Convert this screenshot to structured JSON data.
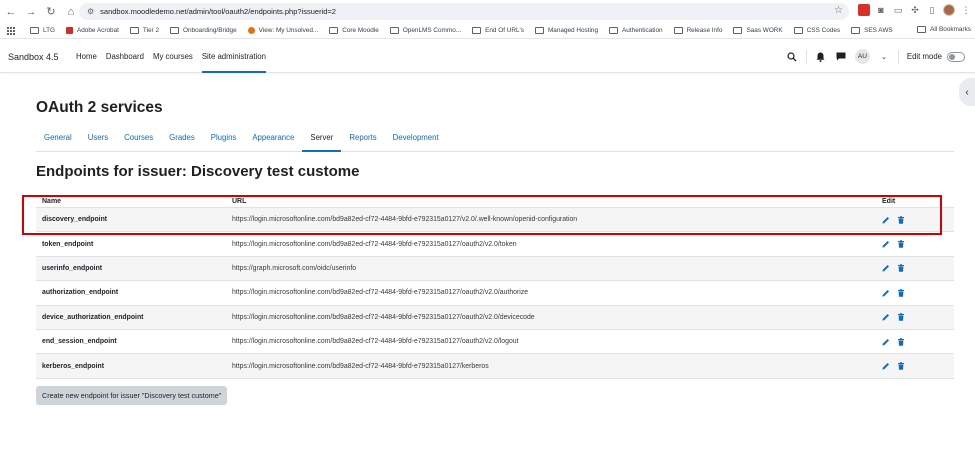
{
  "browser": {
    "url": "sandbox.moodledemo.net/admin/tool/oauth2/endpoints.php?issuerid=2",
    "bookmarks": [
      {
        "label": "LTG",
        "icon": "folder-icon"
      },
      {
        "label": "Adobe Acrobat",
        "icon": "adobe-icon"
      },
      {
        "label": "Tier 2",
        "icon": "folder-icon"
      },
      {
        "label": "Onboarding/Bridge",
        "icon": "folder-icon"
      },
      {
        "label": "View: My Unsolved...",
        "icon": "zendesk-icon"
      },
      {
        "label": "Core Moodle",
        "icon": "folder-icon"
      },
      {
        "label": "OpenLMS Commo...",
        "icon": "folder-icon"
      },
      {
        "label": "End Of URL's",
        "icon": "folder-icon"
      },
      {
        "label": "Managed Hosting",
        "icon": "folder-icon"
      },
      {
        "label": "Authentication",
        "icon": "folder-icon"
      },
      {
        "label": "Release Info",
        "icon": "folder-icon"
      },
      {
        "label": "Saas WORK",
        "icon": "folder-icon"
      },
      {
        "label": "CSS Codes",
        "icon": "folder-icon"
      },
      {
        "label": "SES AWS",
        "icon": "folder-icon"
      }
    ],
    "all_bookmarks": "All Bookmarks"
  },
  "navbar": {
    "brand": "Sandbox 4.5",
    "items": [
      "Home",
      "Dashboard",
      "My courses",
      "Site administration"
    ],
    "user_initials": "AU",
    "edit_mode_label": "Edit mode"
  },
  "page": {
    "heading": "OAuth 2 services",
    "tabs": [
      "General",
      "Users",
      "Courses",
      "Grades",
      "Plugins",
      "Appearance",
      "Server",
      "Reports",
      "Development"
    ],
    "active_tab": "Server",
    "sub_heading": "Endpoints for issuer: Discovery test custome"
  },
  "table": {
    "headers": {
      "name": "Name",
      "url": "URL",
      "edit": "Edit"
    },
    "rows": [
      {
        "name": "discovery_endpoint",
        "url": "https://login.microsoftonline.com/bd9a82ed-cf72-4484-9bfd-e792315a0127/v2.0/.well-known/openid-configuration"
      },
      {
        "name": "token_endpoint",
        "url": "https://login.microsoftonline.com/bd9a82ed-cf72-4484-9bfd-e792315a0127/oauth2/v2.0/token"
      },
      {
        "name": "userinfo_endpoint",
        "url": "https://graph.microsoft.com/oidc/userinfo"
      },
      {
        "name": "authorization_endpoint",
        "url": "https://login.microsoftonline.com/bd9a82ed-cf72-4484-9bfd-e792315a0127/oauth2/v2.0/authorize"
      },
      {
        "name": "device_authorization_endpoint",
        "url": "https://login.microsoftonline.com/bd9a82ed-cf72-4484-9bfd-e792315a0127/oauth2/v2.0/devicecode"
      },
      {
        "name": "end_session_endpoint",
        "url": "https://login.microsoftonline.com/bd9a82ed-cf72-4484-9bfd-e792315a0127/oauth2/v2.0/logout"
      },
      {
        "name": "kerberos_endpoint",
        "url": "https://login.microsoftonline.com/bd9a82ed-cf72-4484-9bfd-e792315a0127/kerberos"
      }
    ]
  },
  "create_button": "Create new endpoint for issuer \"Discovery test custome\"",
  "colors": {
    "accent": "#0f6cbf",
    "highlight_border": "#d40000",
    "delete_icon": "#0f6cbf"
  }
}
